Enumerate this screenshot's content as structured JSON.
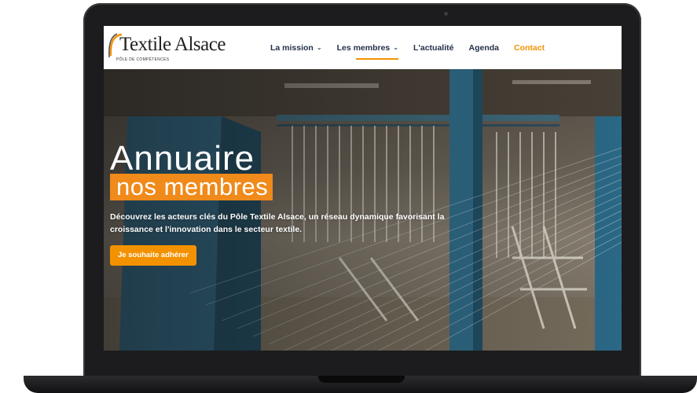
{
  "brand": {
    "name": "Textile Alsace",
    "tagline": "PÔLE DE COMPÉTENCES",
    "accent_color": "#f39200",
    "navy_color": "#23314a"
  },
  "nav": {
    "items": [
      {
        "label": "La mission",
        "has_dropdown": true,
        "icon": "chevron-down-icon"
      },
      {
        "label": "Les membres",
        "has_dropdown": true,
        "icon": "chevron-down-icon",
        "active": true
      },
      {
        "label": "L'actualité",
        "has_dropdown": false
      },
      {
        "label": "Agenda",
        "has_dropdown": false
      },
      {
        "label": "Contact",
        "has_dropdown": false,
        "highlight": true
      }
    ]
  },
  "hero": {
    "title_line1": "Annuaire",
    "title_line2": "nos membres",
    "description": "Découvrez les acteurs clés du Pôle Textile Alsace, un réseau dynamique favorisant la croissance et l'innovation dans le secteur textile.",
    "cta_label": "Je souhaite adhérer",
    "background": "textile-factory-photo"
  }
}
